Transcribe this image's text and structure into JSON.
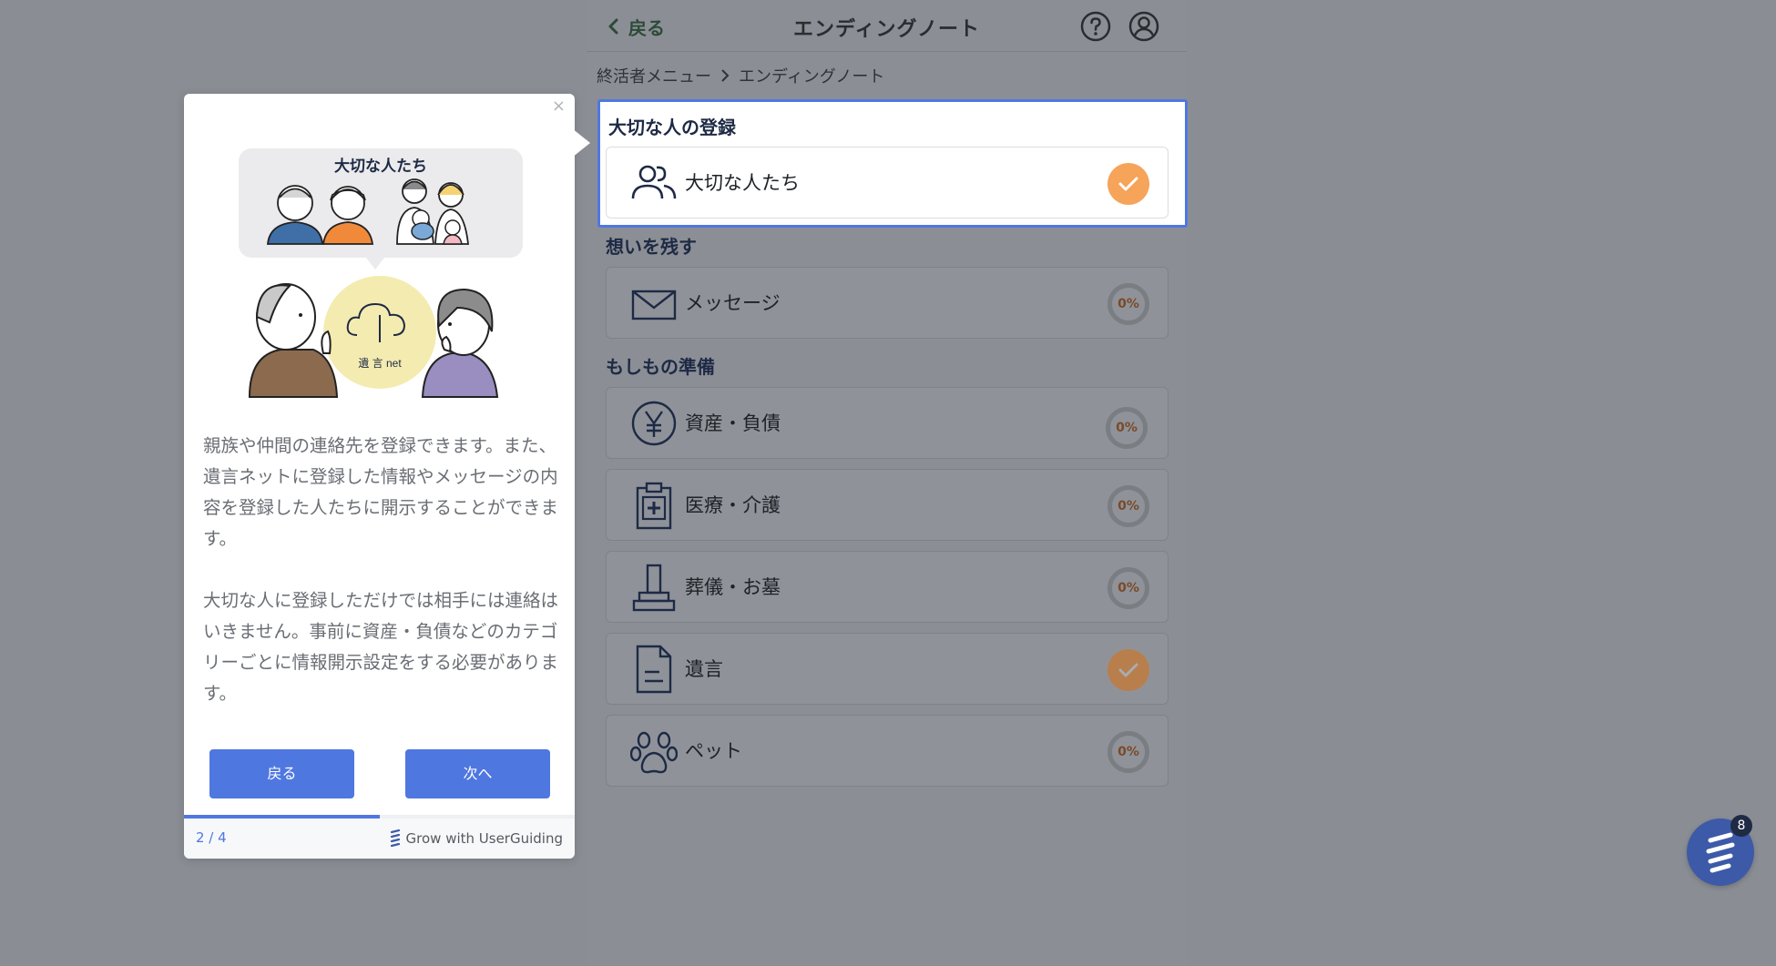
{
  "header": {
    "back_label": "戻る",
    "title": "エンディングノート"
  },
  "breadcrumb": {
    "parent": "終活者メニュー",
    "current": "エンディングノート"
  },
  "sections": {
    "important_people": {
      "title": "大切な人の登録",
      "item": {
        "label": "大切な人たち",
        "status": "complete"
      }
    },
    "messages": {
      "title": "想いを残す",
      "item": {
        "label": "メッセージ",
        "progress": "0%"
      }
    },
    "preparation": {
      "title": "もしもの準備",
      "items": [
        {
          "label": "資産・負債",
          "progress": "0%",
          "icon": "yen-icon"
        },
        {
          "label": "医療・介護",
          "progress": "0%",
          "icon": "medical-clipboard-icon"
        },
        {
          "label": "葬儀・お墓",
          "progress": "0%",
          "icon": "grave-icon"
        },
        {
          "label": "遺言",
          "status": "complete",
          "icon": "document-icon"
        },
        {
          "label": "ペット",
          "progress": "0%",
          "icon": "paw-icon"
        }
      ]
    }
  },
  "tooltip": {
    "close_label": "×",
    "illustration": {
      "bubble_title": "大切な人たち",
      "logo_text": "遺 言 net"
    },
    "paragraph1": "親族や仲間の連絡先を登録できます。また、遺言ネットに登録した情報やメッセージの内容を登録した人たちに開示することができます。",
    "paragraph2": "大切な人に登録しただけでは相手には連絡はいきません。事前に資産・負債などのカテゴリーごとに情報開示設定をする必要があります。",
    "prev_label": "戻る",
    "next_label": "次へ",
    "step": "2 / 4",
    "step_progress": 0.5,
    "powered_by": "Grow with UserGuiding"
  },
  "chat": {
    "badge_count": "8"
  },
  "colors": {
    "accent": "#4f77e0",
    "complete": "#f5a45a",
    "overlay": "#8b8f95"
  }
}
